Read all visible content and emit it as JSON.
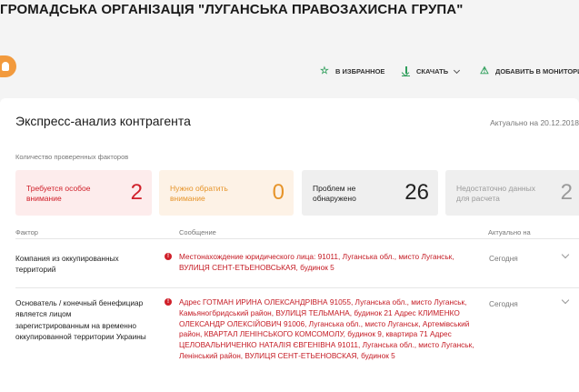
{
  "org": {
    "title": "ГРОМАДСЬКА ОРГАНІЗАЦІЯ \"ЛУГАНСЬКА ПРАВОЗАХИСНА ГРУПА\""
  },
  "actions": {
    "favorite": "В ИЗБРАННОЕ",
    "download": "СКАЧАТЬ",
    "monitoring": "ДОБАВИТЬ В МОНИТОРИН"
  },
  "icons": {
    "favorite": "star-icon",
    "download": "download-icon",
    "dropdown": "chevron-down-icon",
    "monitoring": "monitor-icon",
    "alert": "alert-icon"
  },
  "colors": {
    "accent_green": "#2f9e5b",
    "danger": "#d0202a",
    "warning": "#e6942a",
    "logo": "#f29a3d"
  },
  "express": {
    "title": "Экспресс-анализ контрагента",
    "actual_date": "Актуально на 20.12.2018",
    "factors_caption": "Количество проверенных факторов",
    "tiles": [
      {
        "label": "Требуется особое внимание",
        "count": "2"
      },
      {
        "label": "Нужно обратить внимание",
        "count": "0"
      },
      {
        "label": "Проблем не обнаружено",
        "count": "26"
      },
      {
        "label": "Недостаточно данных для расчета",
        "count": "2"
      }
    ],
    "columns": {
      "factor": "Фактор",
      "message": "Сообщение",
      "actual": "Актуально на"
    },
    "rows": [
      {
        "factor": "Компания из оккупированных территорий",
        "message": "Местонахождение юридического лица: 91011, Луганська обл., мисто Луганськ, ВУЛИЦЯ СЕНТ-ЕТЬЕНОВСЬКАЯ, будинок 5",
        "actual": "Сегодня"
      },
      {
        "factor": "Основатель / конечный бенефициар является лицом зарегистрированным на временно оккупированной территории Украины",
        "message": "Адрес ГОТМАН ИРИНА ОЛЕКСАНДРІВНА 91055, Луганська обл., мисто Луганськ, Камьяногбридський район, ВУЛИЦЯ ТЕЛЬМАНА, будинок 21 Адрес КЛИМЕНКО ОЛЕКСАНДР ОЛЕКСІЙОВИЧ 91006, Луганська обл., мисто Луганськ, Артемівський район, КВАРТАЛ ЛЕНІНСЬКОГО КОМСОМОЛУ, будинок 9, квартира 71 Адрес ЦЕЛОВАЛЬНИЧЕНКО НАТАЛІЯ ЄВГЕНІВНА 91011, Луганська обл., мисто Луганськ, Ленінський район, ВУЛИЦЯ СЕНТ-ЕТЬЕНОВСКАЯ, будинок 5",
        "actual": "Сегодня"
      }
    ]
  }
}
